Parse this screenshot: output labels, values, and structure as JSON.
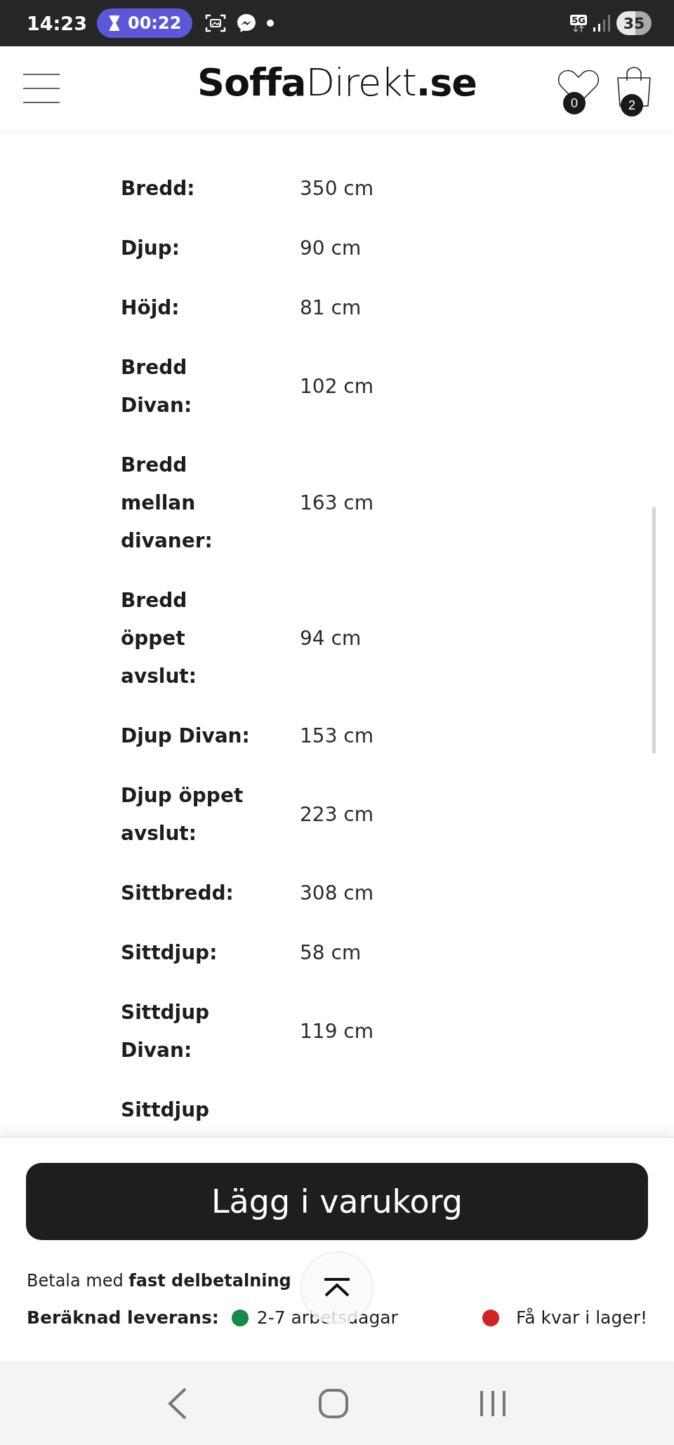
{
  "status_bar": {
    "time": "14:23",
    "timer": "00:22",
    "network": "5G",
    "battery": "35"
  },
  "header": {
    "logo": "**Soffa**Direkt**.se**",
    "wishlist_count": "0",
    "cart_count": "2"
  },
  "specs": [
    {
      "label": "Bredd:",
      "value": "350 cm"
    },
    {
      "label": "Djup:",
      "value": "90 cm"
    },
    {
      "label": "Höjd:",
      "value": "81 cm"
    },
    {
      "label": "Bredd Divan:",
      "value": "102 cm"
    },
    {
      "label": "Bredd mellan divaner:",
      "value": "163 cm"
    },
    {
      "label": "Bredd öppet avslut:",
      "value": "94 cm"
    },
    {
      "label": "Djup Divan:",
      "value": "153 cm"
    },
    {
      "label": "Djup öppet avslut:",
      "value": "223 cm"
    },
    {
      "label": "Sittbredd:",
      "value": "308 cm"
    },
    {
      "label": "Sittdjup:",
      "value": "58 cm"
    },
    {
      "label": "Sittdjup Divan:",
      "value": "119 cm"
    },
    {
      "label": "Sittdjup"
    }
  ],
  "purchase_bar": {
    "button": "Lägg i varukorg",
    "payment": "Betala med **fast delbetalning**",
    "delivery": {
      "label": "Beräknad leverans:",
      "status": "2-7 arbetsdagar",
      "color": "#138a47"
    },
    "stock": {
      "status": "Få kvar i lager!",
      "color": "#d02424"
    }
  }
}
